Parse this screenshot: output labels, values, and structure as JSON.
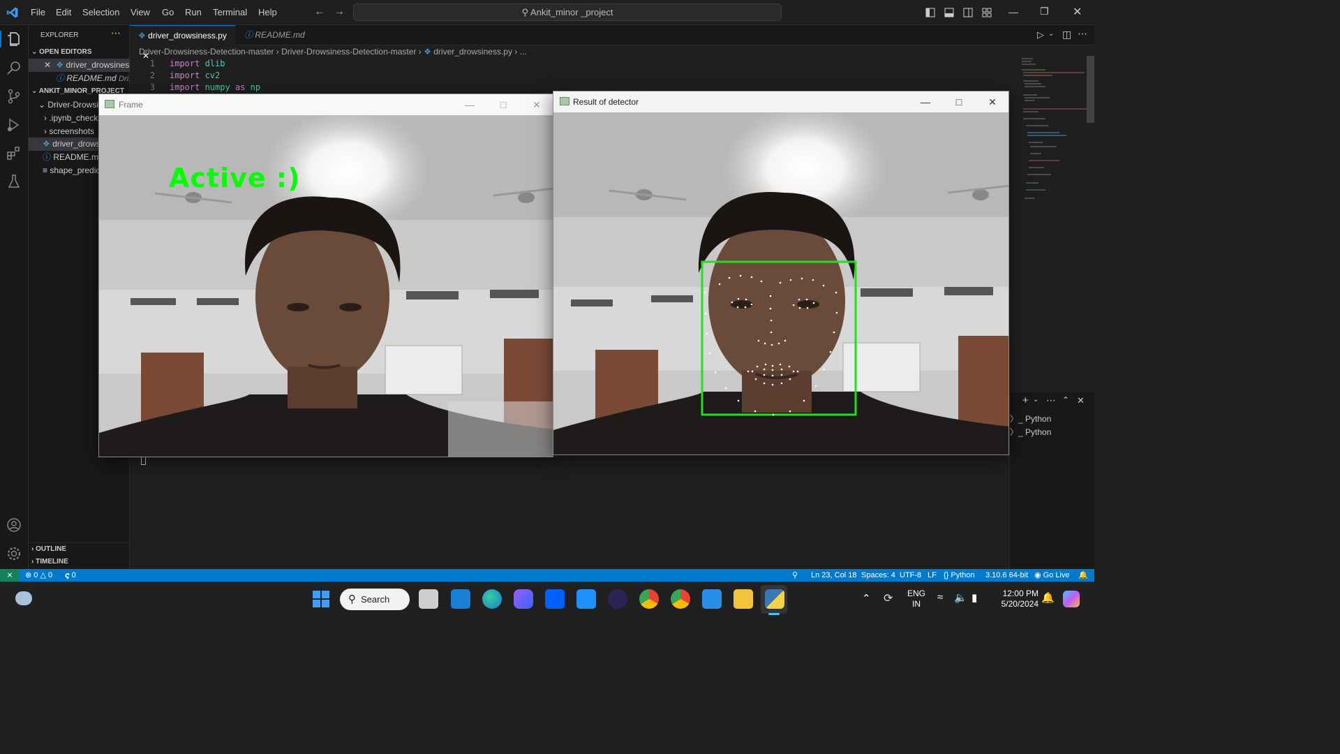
{
  "titlebar": {
    "menu": [
      "File",
      "Edit",
      "Selection",
      "View",
      "Go",
      "Run",
      "Terminal",
      "Help"
    ],
    "search": "Ankit_minor _project"
  },
  "explorer": {
    "title": "EXPLORER",
    "open_editors_label": "OPEN EDITORS",
    "open_editors": [
      {
        "name": "driver_drowsines...",
        "desc": ""
      },
      {
        "name": "README.md",
        "desc": "Dri..."
      }
    ],
    "project_label": "ANKIT_MINOR_PROJECT",
    "folder": "Driver-Drowsin",
    "items": [
      ".ipynb_checkp",
      "screenshots",
      "driver_drowsi",
      "README.md",
      "shape_predic"
    ],
    "outline": "OUTLINE",
    "timeline": "TIMELINE"
  },
  "tabs": [
    {
      "label": "driver_drowsiness.py",
      "active": true
    },
    {
      "label": "README.md",
      "active": false
    }
  ],
  "breadcrumb": [
    "Driver-Drowsiness-Detection-master",
    "Driver-Drowsiness-Detection-master",
    "driver_drowsiness.py",
    "..."
  ],
  "code": [
    {
      "n": "1",
      "kw": "import",
      "rest": " dlib"
    },
    {
      "n": "2",
      "kw": "import",
      "rest": " cv2"
    },
    {
      "n": "3",
      "kw": "import",
      "rest": " numpy ",
      "kw2": "as",
      "rest2": " np"
    }
  ],
  "panel": {
    "terminals": [
      "Python",
      "Python"
    ]
  },
  "frame_window": {
    "title": "Frame",
    "overlay": "Active :)"
  },
  "detector_window": {
    "title": "Result of detector"
  },
  "statusbar": {
    "errors": "0",
    "warnings": "0",
    "ports": "0",
    "position": "Ln 23, Col 18",
    "spaces": "Spaces: 4",
    "encoding": "UTF-8",
    "eol": "LF",
    "language": "Python",
    "interpreter": "3.10.6 64-bit",
    "golive": "Go Live"
  },
  "taskbar": {
    "search": "Search",
    "lang_top": "ENG",
    "lang_bottom": "IN",
    "time": "12:00 PM",
    "date": "5/20/2024"
  },
  "colors": {
    "accent": "#007acc",
    "active_text": "#00ff00",
    "box": "#22dd22"
  }
}
